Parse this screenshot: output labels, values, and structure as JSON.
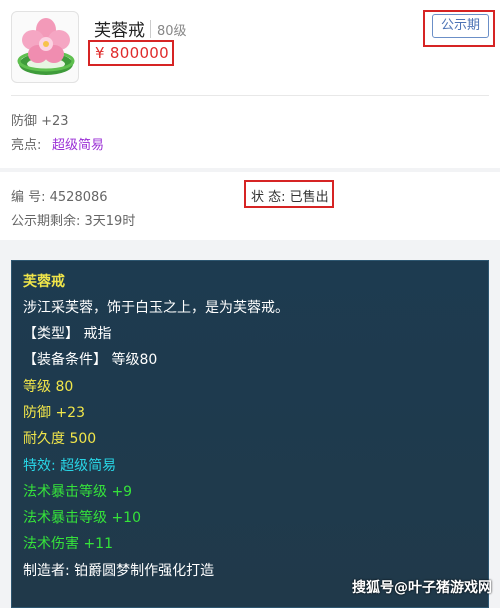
{
  "item": {
    "name": "芙蓉戒",
    "level": "80级",
    "price": "¥ 800000",
    "public_button": "公示期",
    "defense": "防御 +23",
    "highlight_label": "亮点:",
    "highlight_value": "超级简易"
  },
  "meta": {
    "serial": "编 号: 4528086",
    "status": "状 态: 已售出",
    "remaining": "公示期剩余: 3天19时"
  },
  "tooltip": {
    "title": "芙蓉戒",
    "description": "涉江采芙蓉，饰于白玉之上，是为芙蓉戒。",
    "type": "【类型】 戒指",
    "requirement": "【装备条件】 等级80",
    "level": "等级 80",
    "defense": "防御 +23",
    "durability": "耐久度 500",
    "special": "特效:  超级简易",
    "stat1": "法术暴击等级 +9",
    "stat2": "法术暴击等级 +10",
    "stat3": "法术伤害 +11",
    "maker": "制造者:  铂爵圆梦制作强化打造"
  },
  "watermark": "搜狐号@叶子猪游戏网",
  "colors": {
    "price": "#e02a2a",
    "highlight": "#9b30d6",
    "annotation_box": "#d62424",
    "tooltip_bg": "#1f3a4e",
    "tooltip_title": "#f1e64a",
    "tooltip_green": "#35e33a",
    "tooltip_cyan": "#28d6e6"
  },
  "icons": {
    "item_image": "jade-ring-with-pink-flower-icon"
  }
}
